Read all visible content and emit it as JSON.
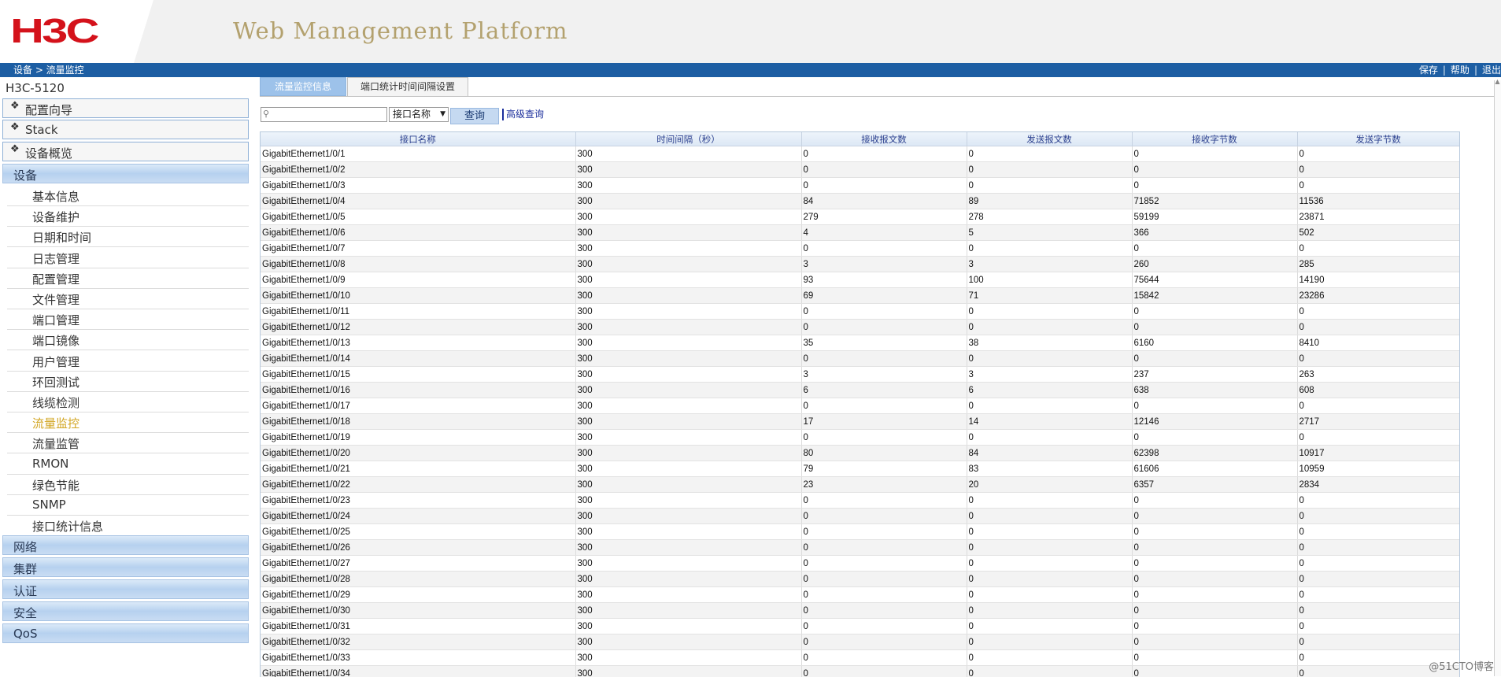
{
  "header": {
    "logo": "H3C",
    "title": "Web Management Platform"
  },
  "bar": {
    "breadcrumb": "设备 > 流量监控",
    "save": "保存",
    "help": "帮助",
    "logout": "退出",
    "sep": "|"
  },
  "sidebar": {
    "device": "H3C-5120",
    "top_items": [
      "配置向导",
      "Stack",
      "设备概览"
    ],
    "section_device": "设备",
    "sub_items": [
      "基本信息",
      "设备维护",
      "日期和时间",
      "日志管理",
      "配置管理",
      "文件管理",
      "端口管理",
      "端口镜像",
      "用户管理",
      "环回测试",
      "线缆检测",
      "流量监控",
      "流量监管",
      "RMON",
      "绿色节能",
      "SNMP",
      "接口统计信息"
    ],
    "active_sub": "流量监控",
    "bottom_sections": [
      "网络",
      "集群",
      "认证",
      "安全",
      "QoS"
    ]
  },
  "tabs": [
    "流量监控信息",
    "端口统计时间间隔设置"
  ],
  "search": {
    "placeholder": "",
    "select_value": "接口名称",
    "query_label": "查询",
    "advanced_label": "高级查询"
  },
  "table": {
    "columns": [
      "接口名称",
      "时间间隔（秒）",
      "接收报文数",
      "发送报文数",
      "接收字节数",
      "发送字节数"
    ],
    "rows": [
      [
        "GigabitEthernet1/0/1",
        "300",
        "0",
        "0",
        "0",
        "0"
      ],
      [
        "GigabitEthernet1/0/2",
        "300",
        "0",
        "0",
        "0",
        "0"
      ],
      [
        "GigabitEthernet1/0/3",
        "300",
        "0",
        "0",
        "0",
        "0"
      ],
      [
        "GigabitEthernet1/0/4",
        "300",
        "84",
        "89",
        "71852",
        "11536"
      ],
      [
        "GigabitEthernet1/0/5",
        "300",
        "279",
        "278",
        "59199",
        "23871"
      ],
      [
        "GigabitEthernet1/0/6",
        "300",
        "4",
        "5",
        "366",
        "502"
      ],
      [
        "GigabitEthernet1/0/7",
        "300",
        "0",
        "0",
        "0",
        "0"
      ],
      [
        "GigabitEthernet1/0/8",
        "300",
        "3",
        "3",
        "260",
        "285"
      ],
      [
        "GigabitEthernet1/0/9",
        "300",
        "93",
        "100",
        "75644",
        "14190"
      ],
      [
        "GigabitEthernet1/0/10",
        "300",
        "69",
        "71",
        "15842",
        "23286"
      ],
      [
        "GigabitEthernet1/0/11",
        "300",
        "0",
        "0",
        "0",
        "0"
      ],
      [
        "GigabitEthernet1/0/12",
        "300",
        "0",
        "0",
        "0",
        "0"
      ],
      [
        "GigabitEthernet1/0/13",
        "300",
        "35",
        "38",
        "6160",
        "8410"
      ],
      [
        "GigabitEthernet1/0/14",
        "300",
        "0",
        "0",
        "0",
        "0"
      ],
      [
        "GigabitEthernet1/0/15",
        "300",
        "3",
        "3",
        "237",
        "263"
      ],
      [
        "GigabitEthernet1/0/16",
        "300",
        "6",
        "6",
        "638",
        "608"
      ],
      [
        "GigabitEthernet1/0/17",
        "300",
        "0",
        "0",
        "0",
        "0"
      ],
      [
        "GigabitEthernet1/0/18",
        "300",
        "17",
        "14",
        "12146",
        "2717"
      ],
      [
        "GigabitEthernet1/0/19",
        "300",
        "0",
        "0",
        "0",
        "0"
      ],
      [
        "GigabitEthernet1/0/20",
        "300",
        "80",
        "84",
        "62398",
        "10917"
      ],
      [
        "GigabitEthernet1/0/21",
        "300",
        "79",
        "83",
        "61606",
        "10959"
      ],
      [
        "GigabitEthernet1/0/22",
        "300",
        "23",
        "20",
        "6357",
        "2834"
      ],
      [
        "GigabitEthernet1/0/23",
        "300",
        "0",
        "0",
        "0",
        "0"
      ],
      [
        "GigabitEthernet1/0/24",
        "300",
        "0",
        "0",
        "0",
        "0"
      ],
      [
        "GigabitEthernet1/0/25",
        "300",
        "0",
        "0",
        "0",
        "0"
      ],
      [
        "GigabitEthernet1/0/26",
        "300",
        "0",
        "0",
        "0",
        "0"
      ],
      [
        "GigabitEthernet1/0/27",
        "300",
        "0",
        "0",
        "0",
        "0"
      ],
      [
        "GigabitEthernet1/0/28",
        "300",
        "0",
        "0",
        "0",
        "0"
      ],
      [
        "GigabitEthernet1/0/29",
        "300",
        "0",
        "0",
        "0",
        "0"
      ],
      [
        "GigabitEthernet1/0/30",
        "300",
        "0",
        "0",
        "0",
        "0"
      ],
      [
        "GigabitEthernet1/0/31",
        "300",
        "0",
        "0",
        "0",
        "0"
      ],
      [
        "GigabitEthernet1/0/32",
        "300",
        "0",
        "0",
        "0",
        "0"
      ],
      [
        "GigabitEthernet1/0/33",
        "300",
        "0",
        "0",
        "0",
        "0"
      ],
      [
        "GigabitEthernet1/0/34",
        "300",
        "0",
        "0",
        "0",
        "0"
      ]
    ]
  },
  "watermark": "@51CTO博客",
  "colors": {
    "brand_red": "#d4121b",
    "bar_blue": "#1d5ea3",
    "active_item": "#d2a520",
    "tab_active": "#9dc2ea"
  }
}
